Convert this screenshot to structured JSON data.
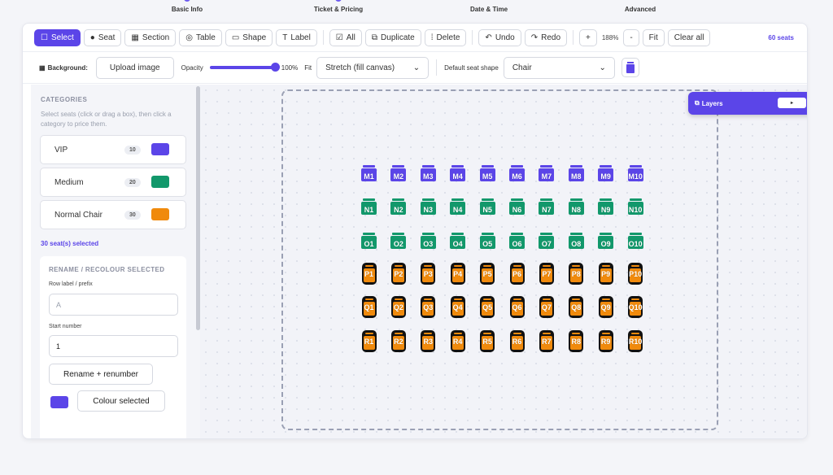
{
  "steps": [
    "Basic Info",
    "Ticket & Pricing",
    "Date & Time",
    "Advanced"
  ],
  "toolbar": {
    "select": "Select",
    "seat": "Seat",
    "section": "Section",
    "table": "Table",
    "shape": "Shape",
    "label": "Label",
    "all": "All",
    "duplicate": "Duplicate",
    "delete": "Delete",
    "undo": "Undo",
    "redo": "Redo",
    "zoom_in": "+",
    "zoom": "188%",
    "zoom_out": "-",
    "fit": "Fit",
    "clear_all": "Clear all",
    "seat_count": "60 seats"
  },
  "background": {
    "label": "Background:",
    "upload": "Upload image",
    "opacity_label": "Opacity",
    "opacity_value": "100%",
    "opacity_fraction": 1.0,
    "fit_label": "Fit",
    "fit_value": "Stretch (fill canvas)",
    "shape_label": "Default seat shape",
    "shape_value": "Chair"
  },
  "sidebar": {
    "title": "CATEGORIES",
    "help": "Select seats (click or drag a box), then click a category to price them.",
    "categories": [
      {
        "name": "VIP",
        "count": "10",
        "color": "#5b45e8"
      },
      {
        "name": "Medium",
        "count": "20",
        "color": "#12986b"
      },
      {
        "name": "Normal Chair",
        "count": "30",
        "color": "#f08a0c"
      }
    ],
    "selected": "30 seat(s) selected",
    "rename": {
      "title": "RENAME / RECOLOUR SELECTED",
      "row_label": "Row label / prefix",
      "row_placeholder": "A",
      "start_label": "Start number",
      "start_value": "1",
      "rename_btn": "Rename + renumber",
      "colour_btn": "Colour selected"
    }
  },
  "layers": {
    "label": "Layers",
    "toggle": "▸"
  },
  "seat_rows": [
    {
      "row": "M",
      "color": "#5b45e8",
      "selected": false
    },
    {
      "row": "N",
      "color": "#12986b",
      "selected": false
    },
    {
      "row": "O",
      "color": "#12986b",
      "selected": false
    },
    {
      "row": "P",
      "color": "#f08a0c",
      "selected": true
    },
    {
      "row": "Q",
      "color": "#f08a0c",
      "selected": true
    },
    {
      "row": "R",
      "color": "#f08a0c",
      "selected": true
    }
  ],
  "seats_per_row": 10
}
